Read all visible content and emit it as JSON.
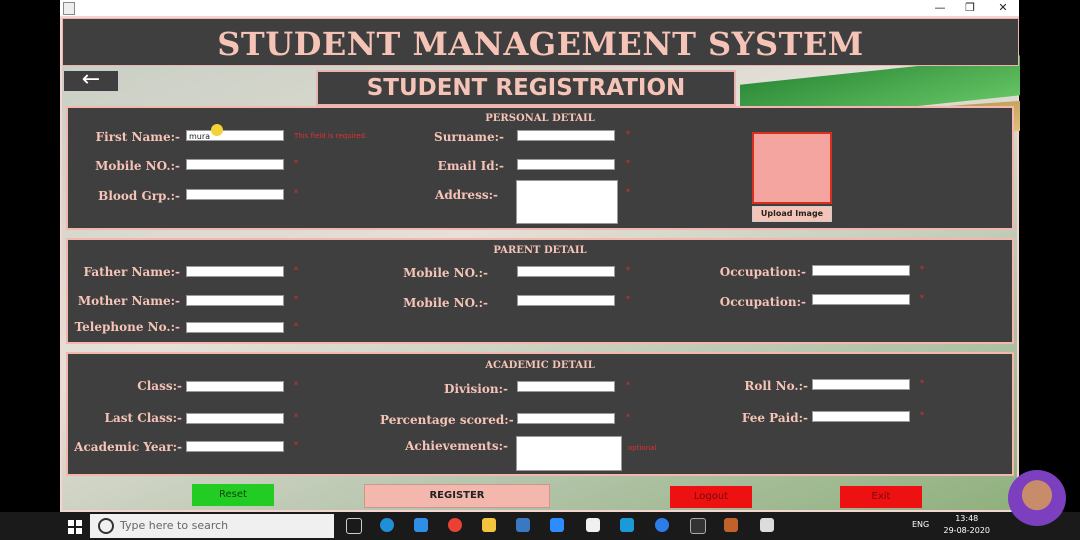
{
  "window": {
    "title": "",
    "minimize": "—",
    "maximize": "❐",
    "close": "✕"
  },
  "header": {
    "title": "STUDENT MANAGEMENT SYSTEM"
  },
  "nav": {
    "back_label": "←"
  },
  "subheader": {
    "title": "STUDENT REGISTRATION"
  },
  "personal": {
    "section_title": "PERSONAL DETAIL",
    "first_name_label": "First Name:-",
    "first_name_value": "mura",
    "first_name_error": "This field is required.",
    "surname_label": "Surname:-",
    "mobile_label": "Mobile NO.:-",
    "email_label": "Email Id:-",
    "blood_label": "Blood Grp.:-",
    "address_label": "Address:-",
    "upload_label": "Upload Image",
    "required_mark": "*"
  },
  "parent": {
    "section_title": "PARENT DETAIL",
    "father_label": "Father Name:-",
    "mother_label": "Mother Name:-",
    "telephone_label": "Telephone No.:-",
    "mobile1_label": "Mobile NO.:-",
    "mobile2_label": "Mobile NO.:-",
    "occupation1_label": "Occupation:-",
    "occupation2_label": "Occupation:-"
  },
  "academic": {
    "section_title": "ACADEMIC DETAIL",
    "class_label": "Class:-",
    "last_class_label": "Last Class:-",
    "academic_year_label": "Academic Year:-",
    "division_label": "Division:-",
    "percentage_label": "Percentage scored:-",
    "achievements_label": "Achievements:-",
    "achievements_note": "optional",
    "roll_label": "Roll No.:-",
    "fee_label": "Fee Paid:-"
  },
  "actions": {
    "reset": "Reset",
    "register": "REGISTER",
    "logout": "Logout",
    "exit": "Exit"
  },
  "taskbar": {
    "search_placeholder": "Type here to search",
    "lang": "ENG",
    "time": "13:48",
    "date": "29-08-2020"
  },
  "colors": {
    "panel": "#3f3f3f",
    "accent": "#f6c4b7",
    "reset": "#22cc22",
    "danger": "#ee1111",
    "register": "#f4b7ae"
  }
}
